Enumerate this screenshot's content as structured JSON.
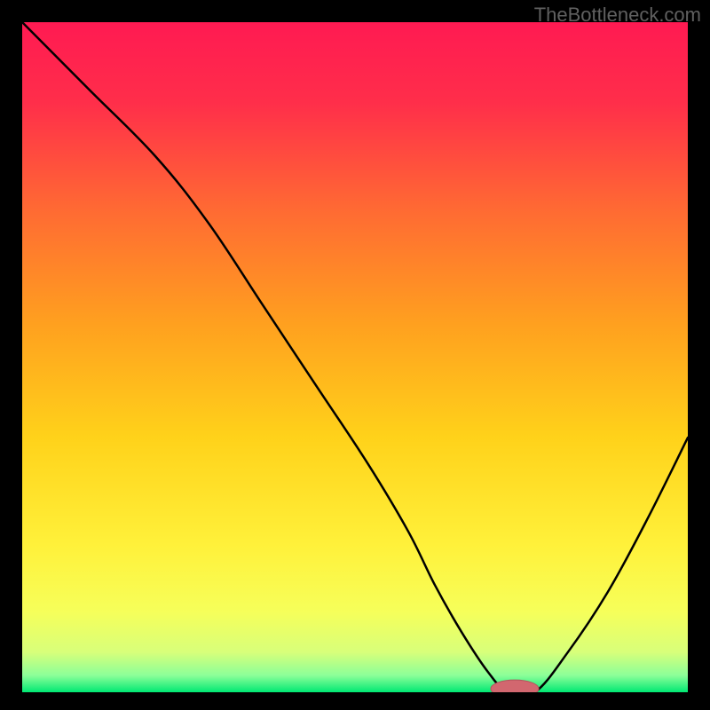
{
  "watermark": "TheBottleneck.com",
  "colors": {
    "black": "#000000",
    "curve": "#000000",
    "watermark_text": "#606060",
    "gradient_stops": [
      {
        "offset": 0.0,
        "color": "#ff1a52"
      },
      {
        "offset": 0.12,
        "color": "#ff2e4a"
      },
      {
        "offset": 0.28,
        "color": "#ff6a33"
      },
      {
        "offset": 0.45,
        "color": "#ffa01f"
      },
      {
        "offset": 0.62,
        "color": "#ffd21a"
      },
      {
        "offset": 0.78,
        "color": "#fff13a"
      },
      {
        "offset": 0.88,
        "color": "#f6ff5a"
      },
      {
        "offset": 0.94,
        "color": "#d8ff7a"
      },
      {
        "offset": 0.975,
        "color": "#8bff99"
      },
      {
        "offset": 1.0,
        "color": "#00e873"
      }
    ],
    "marker_fill": "#d2676f",
    "marker_stroke": "#b3555d"
  },
  "chart_data": {
    "type": "line",
    "title": "",
    "xlabel": "",
    "ylabel": "",
    "xlim": [
      0,
      100
    ],
    "ylim": [
      0,
      100
    ],
    "x": [
      0,
      10,
      20,
      28,
      36,
      44,
      52,
      58,
      62,
      66,
      70,
      73,
      77,
      82,
      88,
      94,
      100
    ],
    "values": [
      100,
      90,
      80,
      70,
      58,
      46,
      34,
      24,
      16,
      9,
      3,
      0,
      0,
      6,
      15,
      26,
      38
    ],
    "marker": {
      "x": 74,
      "y": 0,
      "rx": 3.6,
      "ry": 1.3
    },
    "note": "x/y are percent of plot area; y=0 at bottom (green), y=100 at top (red). Values estimated from pixels; no axes or labels are present in the source image."
  }
}
